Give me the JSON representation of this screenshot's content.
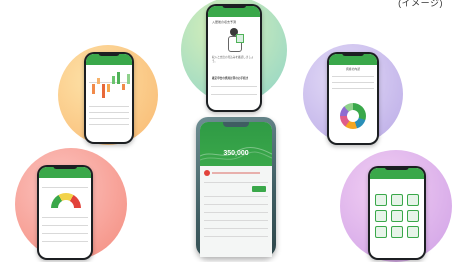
{
  "header": {
    "corner_text": "(イメージ)"
  },
  "phones": {
    "top_center": {
      "title": "入居後の収支予測",
      "body": "収入と支出の見込みを確認しましょう。",
      "footer": "確定申告の費用計算のお手続き"
    },
    "center": {
      "amount": "350,000"
    },
    "right_top": {
      "heading": "資産の内訳"
    }
  },
  "colors": {
    "brand_green": "#3aa84a",
    "circle_orange": "#fbc47d",
    "circle_teal_green": "#a9dcc0",
    "circle_lavender": "#d2c8ee",
    "circle_pink": "#f8a3a0",
    "circle_violet": "#e3b9ea"
  }
}
